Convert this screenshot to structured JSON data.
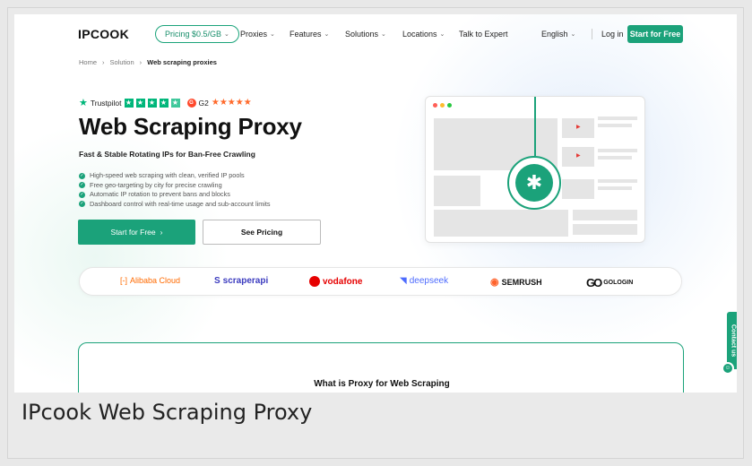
{
  "nav": {
    "logo": "IPCOOK",
    "pricing": "Pricing $0.5/GB",
    "items": [
      "Proxies",
      "Features",
      "Solutions",
      "Locations"
    ],
    "talk": "Talk to Expert",
    "language": "English",
    "login": "Log in",
    "cta": "Start for Free"
  },
  "breadcrumb": [
    "Home",
    "Solution",
    "Web scraping proxies"
  ],
  "ratings": {
    "trustpilot": "Trustpilot",
    "g2": "G2"
  },
  "hero": {
    "title": "Web Scraping Proxy",
    "subtitle": "Fast & Stable Rotating IPs for Ban-Free Crawling",
    "features": [
      "High-speed web scraping with clean, verified IP pools",
      "Free geo-targeting by city for precise crawling",
      "Automatic IP rotation to prevent bans and blocks",
      "Dashboard control with real-time usage and sub-account limits"
    ],
    "primary_button": "Start for Free",
    "secondary_button": "See Pricing"
  },
  "brands": [
    "Alibaba Cloud",
    "scraperapi",
    "vodafone",
    "deepseek",
    "SEMRUSH",
    "GOLOGIN"
  ],
  "section_title": "What is Proxy for Web Scraping",
  "contact_tab": "Contact us",
  "caption": "IPcook Web Scraping Proxy",
  "colors": {
    "accent": "#1ba27a",
    "trustpilot": "#00b67a",
    "g2": "#ff492c"
  }
}
